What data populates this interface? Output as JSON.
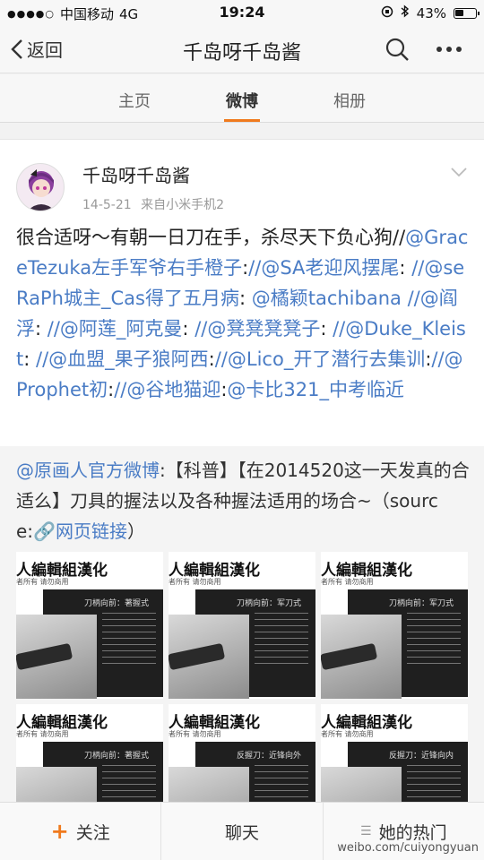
{
  "status_bar": {
    "signal": "●●●●○",
    "carrier": "中国移动",
    "network": "4G",
    "time": "19:24",
    "battery": "43%"
  },
  "navbar": {
    "back_label": "返回",
    "title": "千岛呀千岛酱"
  },
  "tabs": [
    {
      "label": "主页",
      "active": false
    },
    {
      "label": "微博",
      "active": true
    },
    {
      "label": "相册",
      "active": false
    }
  ],
  "post": {
    "author": "千岛呀千岛酱",
    "date": "14-5-21",
    "source": "来自小米手机2",
    "text_intro": "很合适呀～有朝一日刀在手，杀尽天下负心狗//",
    "mentions": [
      {
        "name": "@GraceTezuka左手军爷右手橙子",
        "after": ":"
      },
      {
        "name": "//@SA老迎风摆尾",
        "after": ": "
      },
      {
        "name": "//@seRaPh城主_Cas得了五月病",
        "after": ": "
      },
      {
        "name": "@橘颖tachibana",
        "after": " "
      },
      {
        "name": "//@阎浮",
        "after": ": "
      },
      {
        "name": "//@阿莲_阿克曼",
        "after": ": "
      },
      {
        "name": "//@凳凳凳凳子",
        "after": ": "
      },
      {
        "name": "//@Duke_Kleist",
        "after": ": "
      },
      {
        "name": "//@血盟_果子狼阿西",
        "after": ":"
      },
      {
        "name": "//@Lico_开了潜行去集训",
        "after": ":"
      },
      {
        "name": "//@Prophet初",
        "after": ":"
      },
      {
        "name": "//@谷地猫迎",
        "after": ":"
      },
      {
        "name": "@卡比321_中考临近",
        "after": ""
      }
    ]
  },
  "repost": {
    "origin": "@原画人官方微博",
    "text": ":【科普】【在2014520这一天发真的合适么】刀具的握法以及各种握法适用的场合~（source:",
    "link_icon": "🔗",
    "link_label": "网页链接",
    "closing": "）",
    "images": [
      {
        "header": "人編輯組漢化",
        "sub": "者所有 请勿商用",
        "panel_title": "刀柄向前：著握式"
      },
      {
        "header": "人編輯組漢化",
        "sub": "者所有 请勿商用",
        "panel_title": "刀柄向前：军刀式"
      },
      {
        "header": "人編輯組漢化",
        "sub": "者所有 请勿商用",
        "panel_title": "刀柄向前：军刀式"
      },
      {
        "header": "人編輯組漢化",
        "sub": "者所有 请勿商用",
        "panel_title": "刀柄向前：著握式"
      },
      {
        "header": "人編輯組漢化",
        "sub": "者所有 请勿商用",
        "panel_title": "反握刀：近锋向外"
      },
      {
        "header": "人編輯組漢化",
        "sub": "者所有 请勿商用",
        "panel_title": "反握刀：近锋向内"
      }
    ]
  },
  "bottom_bar": {
    "follow_label": "关注",
    "chat_label": "聊天",
    "hot_label": "她的热门",
    "watermark": "weibo.com/cuiyongyuan"
  }
}
